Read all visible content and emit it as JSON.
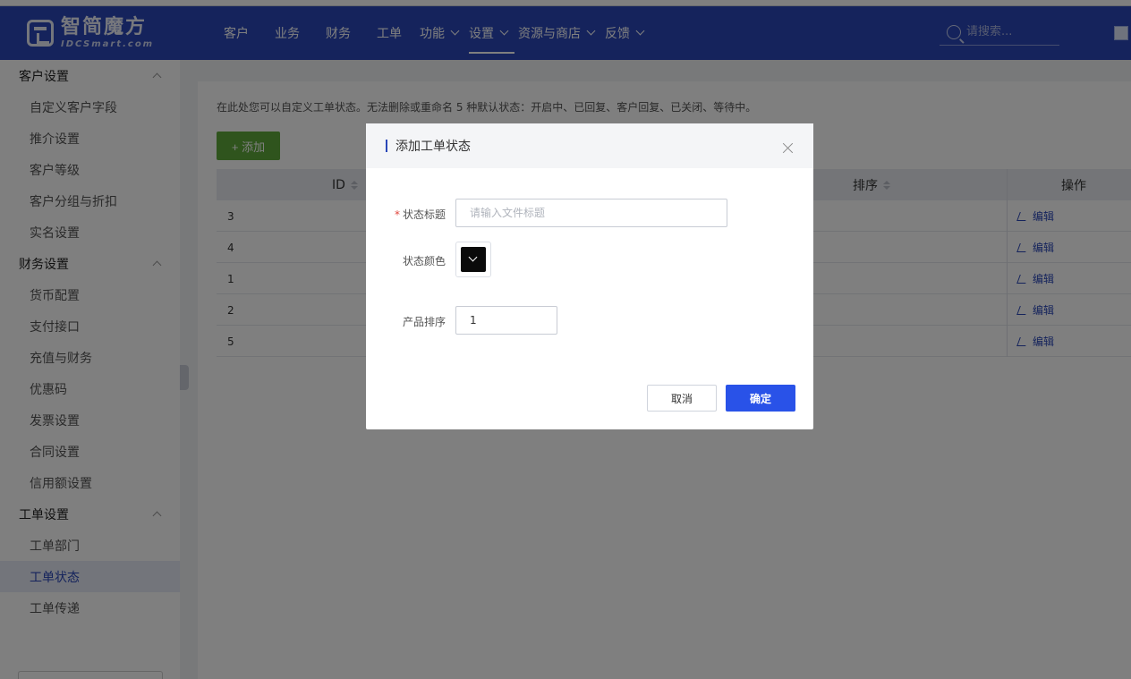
{
  "header": {
    "logo_name": "智简魔方",
    "logo_sub": "IDCSmart.com",
    "nav": [
      {
        "label": "客户",
        "has_dropdown": false,
        "active": false
      },
      {
        "label": "业务",
        "has_dropdown": false,
        "active": false
      },
      {
        "label": "财务",
        "has_dropdown": false,
        "active": false
      },
      {
        "label": "工单",
        "has_dropdown": false,
        "active": false
      },
      {
        "label": "功能",
        "has_dropdown": true,
        "active": false
      },
      {
        "label": "设置",
        "has_dropdown": true,
        "active": true
      },
      {
        "label": "资源与商店",
        "has_dropdown": true,
        "active": false
      },
      {
        "label": "反馈",
        "has_dropdown": true,
        "active": false
      }
    ],
    "search_placeholder": "请搜索...",
    "brand_color": "#2a47b8"
  },
  "sidebar": {
    "groups": [
      {
        "label": "客户设置",
        "items": [
          "自定义客户字段",
          "推介设置",
          "客户等级",
          "客户分组与折扣",
          "实名设置"
        ]
      },
      {
        "label": "财务设置",
        "items": [
          "货币配置",
          "支付接口",
          "充值与财务",
          "优惠码",
          "发票设置",
          "合同设置",
          "信用额设置"
        ]
      },
      {
        "label": "工单设置",
        "items": [
          "工单部门",
          "工单状态",
          "工单传递"
        ]
      }
    ],
    "active_item": "工单状态"
  },
  "main": {
    "hint": "在此处您可以自定义工单状态。无法删除或重命名 5 种默认状态：开启中、已回复、客户回复、已关闭、等待中。",
    "add_button": "+ 添加",
    "columns": {
      "id": "ID",
      "order": "排序",
      "action": "操作"
    },
    "rows": [
      {
        "id": "3",
        "action": "编辑"
      },
      {
        "id": "4",
        "action": "编辑"
      },
      {
        "id": "1",
        "action": "编辑"
      },
      {
        "id": "2",
        "action": "编辑"
      },
      {
        "id": "5",
        "action": "编辑"
      }
    ]
  },
  "modal": {
    "title": "添加工单状态",
    "fields": {
      "status_title_label": "状态标题",
      "status_title_required": "*",
      "status_title_placeholder": "请输入文件标题",
      "status_title_value": "",
      "status_color_label": "状态颜色",
      "status_color_value": "#0a0a0a",
      "order_label": "产品排序",
      "order_value": "1"
    },
    "cancel": "取消",
    "confirm": "确定",
    "confirm_color": "#2952e8"
  }
}
